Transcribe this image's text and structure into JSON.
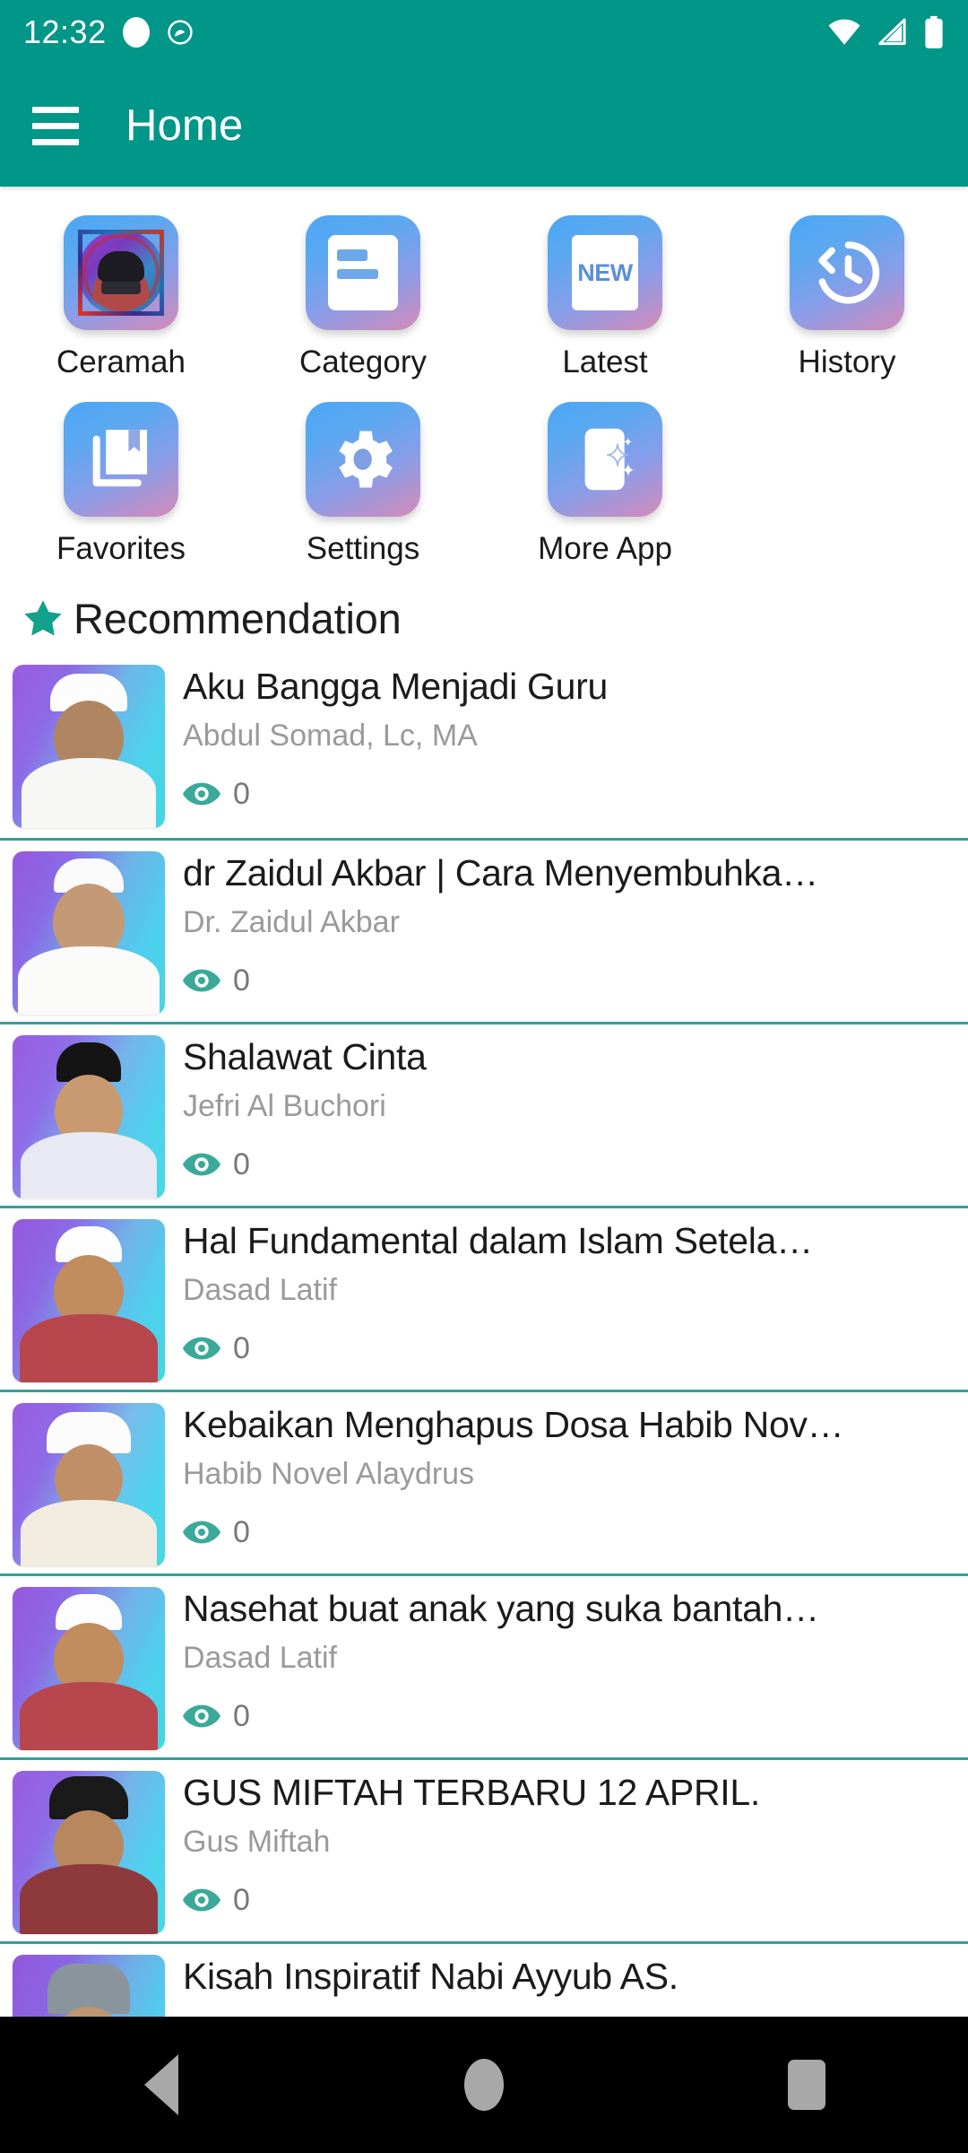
{
  "status_bar": {
    "time": "12:32",
    "icons": [
      "dot-icon",
      "do-not-disturb-icon",
      "wifi-icon",
      "cell-signal-icon",
      "battery-icon"
    ]
  },
  "app_bar": {
    "menu_icon": "hamburger-menu-icon",
    "title": "Home"
  },
  "menu_grid": [
    {
      "label": "Ceramah",
      "icon": "avatar-icon"
    },
    {
      "label": "Category",
      "icon": "document-list-icon"
    },
    {
      "label": "Latest",
      "icon": "new-badge-icon"
    },
    {
      "label": "History",
      "icon": "history-clock-icon"
    },
    {
      "label": "Favorites",
      "icon": "bookmark-book-icon"
    },
    {
      "label": "Settings",
      "icon": "gear-icon"
    },
    {
      "label": "More App",
      "icon": "phone-sparkle-icon"
    }
  ],
  "section": {
    "icon": "star-icon",
    "title": "Recommendation"
  },
  "colors": {
    "primary": "#009688",
    "divider": "#3a9e98",
    "eye": "#3aa99a",
    "title_text": "#1b1b1b",
    "subtitle_text": "#9a9a9a",
    "nav_background": "#000000"
  },
  "list": [
    {
      "title": "Aku Bangga Menjadi Guru",
      "author": "Abdul Somad, Lc, MA",
      "views": "0",
      "views_icon": "eye-icon"
    },
    {
      "title": "dr Zaidul Akbar | Cara Menyembuhka…",
      "author": "Dr. Zaidul Akbar",
      "views": "0",
      "views_icon": "eye-icon"
    },
    {
      "title": "Shalawat Cinta",
      "author": "Jefri Al Buchori",
      "views": "0",
      "views_icon": "eye-icon"
    },
    {
      "title": "Hal Fundamental dalam Islam Setela…",
      "author": "Dasad Latif",
      "views": "0",
      "views_icon": "eye-icon"
    },
    {
      "title": "Kebaikan Menghapus Dosa Habib Nov…",
      "author": "Habib Novel Alaydrus",
      "views": "0",
      "views_icon": "eye-icon"
    },
    {
      "title": "Nasehat buat anak yang suka bantah…",
      "author": "Dasad Latif",
      "views": "0",
      "views_icon": "eye-icon"
    },
    {
      "title": "GUS MIFTAH TERBARU 12 APRIL.",
      "author": "Gus Miftah",
      "views": "0",
      "views_icon": "eye-icon"
    },
    {
      "title": "Kisah Inspiratif Nabi Ayyub AS.",
      "author": "",
      "views": "",
      "views_icon": "eye-icon"
    }
  ],
  "nav_bar": {
    "back": "back-triangle-icon",
    "home": "home-circle-icon",
    "recent": "recent-square-icon"
  }
}
